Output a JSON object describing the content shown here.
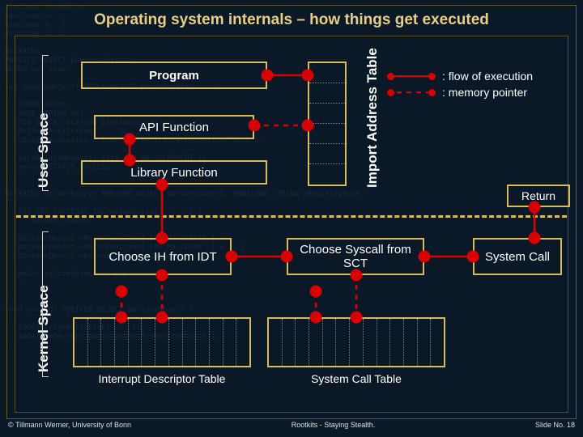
{
  "title": "Operating system internals – how things get executed",
  "labels": {
    "user_space": "User Space",
    "kernel_space": "Kernel Space",
    "iat": "Import Address Table"
  },
  "boxes": {
    "program": "Program",
    "api_fn": "API Function",
    "lib_fn": "Library Function",
    "choose_ih": "Choose IH from IDT",
    "choose_sys": "Choose Syscall from SCT",
    "syscall": "System Call",
    "return": "Return",
    "idt": "Interrupt Descriptor Table",
    "sct": "System Call Table"
  },
  "legend": {
    "flow": ": flow of execution",
    "ptr": ": memory pointer"
  },
  "footer": {
    "left": "© Tillmann Werner, University of Bonn",
    "center": "Rootkits - Staying Stealth.",
    "right": "Slide No. 18"
  },
  "colors": {
    "accent": "#d8bc58",
    "flow": "#d80000",
    "bg": "#0a1828"
  },
  "iat_rows": 6,
  "table_cols": 13
}
